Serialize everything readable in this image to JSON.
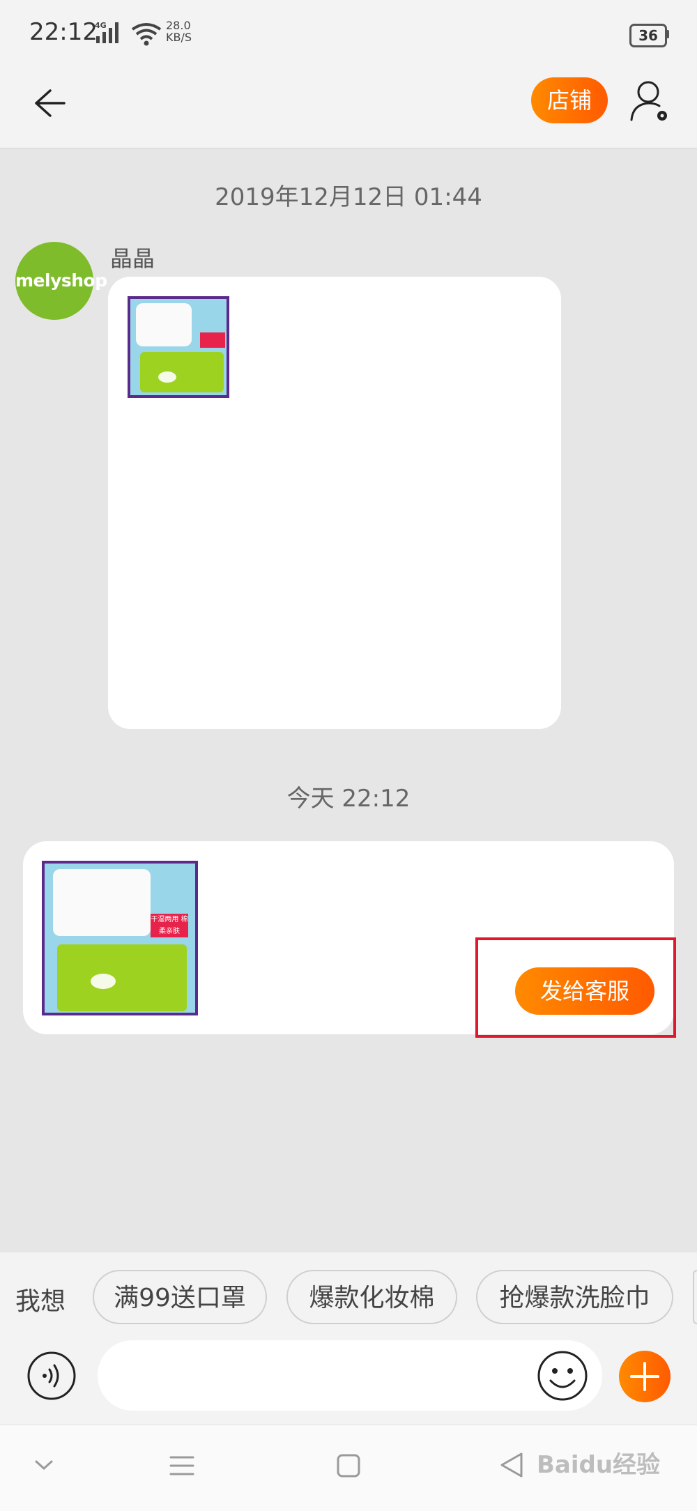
{
  "status_bar": {
    "time": "22:12",
    "network": "4G",
    "speed_value": "28.0",
    "speed_unit": "KB/S",
    "battery": "36"
  },
  "nav": {
    "shop_label": "店铺"
  },
  "chat": {
    "timestamp_1": "2019年12月12日 01:44",
    "sender_name": "晶晶",
    "avatar_text": "melyshop",
    "timestamp_2": "今天  22:12",
    "product_tag": "干湿两用 棉柔亲肤",
    "send_button_label": "发给客服"
  },
  "suggestions": {
    "label": "我想",
    "chips": [
      "满99送口罩",
      "爆款化妆棉",
      "抢爆款洗脸巾"
    ]
  },
  "input": {
    "placeholder": ""
  },
  "watermark": "Baidu经验",
  "colors": {
    "accent": "#ff6a00",
    "highlight_border": "#e0182a",
    "avatar_bg": "#7fbc2c"
  }
}
